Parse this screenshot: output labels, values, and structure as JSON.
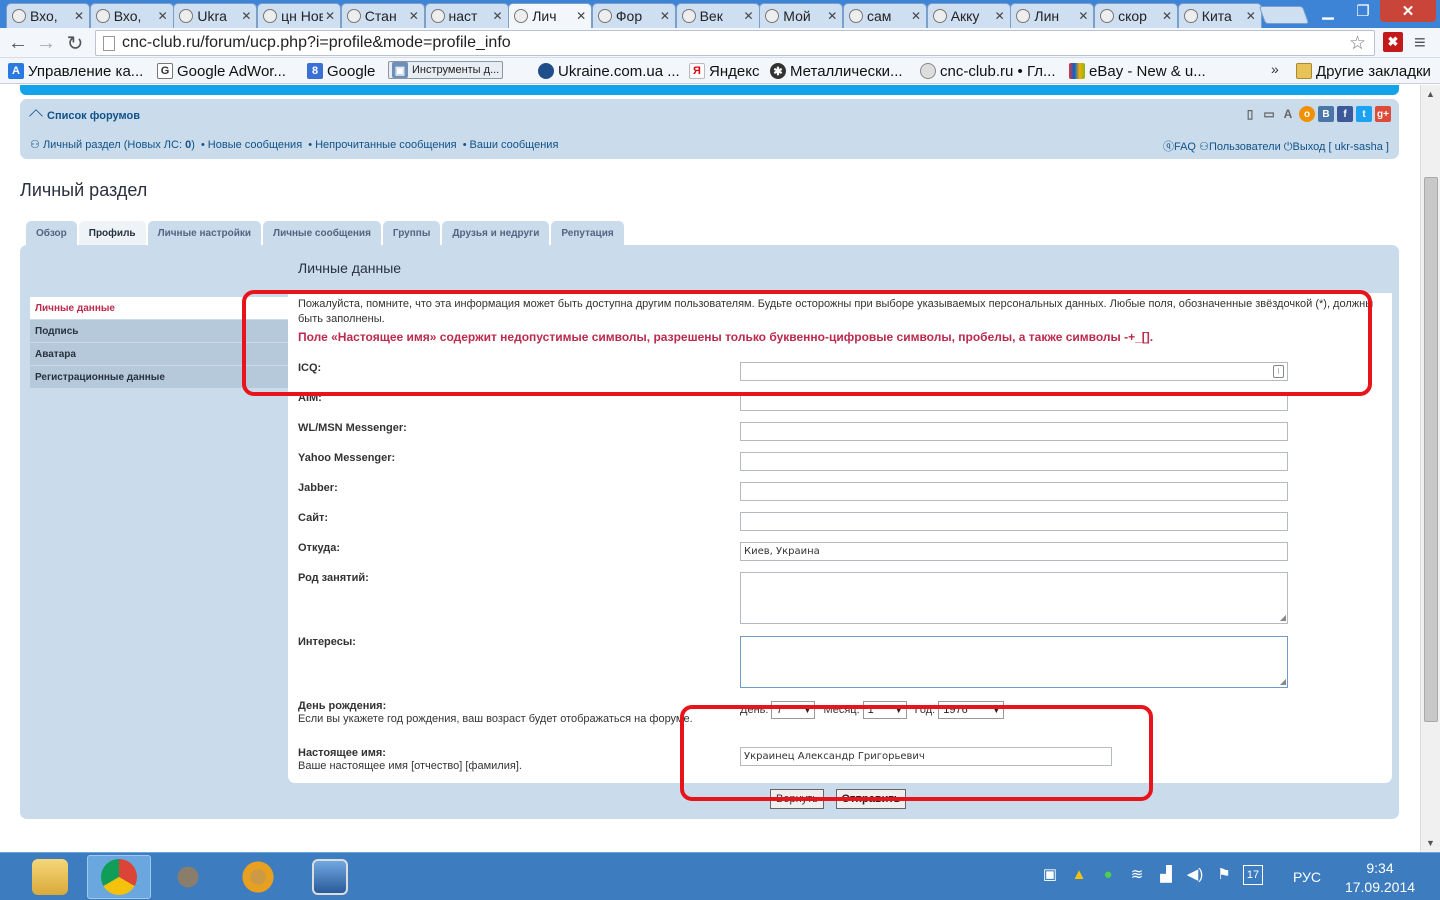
{
  "browser": {
    "tabs": [
      {
        "label": "Вхо,",
        "icon": "mail-icon"
      },
      {
        "label": "Вхо,",
        "icon": "gmail-icon"
      },
      {
        "label": "Ukra",
        "icon": "globe-icon"
      },
      {
        "label": "цн Нов",
        "icon": "site-icon"
      },
      {
        "label": "Стан",
        "icon": "cnc-icon"
      },
      {
        "label": "наст",
        "icon": "gear-icon"
      },
      {
        "label": "Лич",
        "icon": "cnc-icon"
      },
      {
        "label": "Фор",
        "icon": "cnc-icon"
      },
      {
        "label": "Век",
        "icon": "cnc-icon"
      },
      {
        "label": "Мой",
        "icon": "cnc-icon"
      },
      {
        "label": "сам",
        "icon": "cnc-icon"
      },
      {
        "label": "Акку",
        "icon": "cnc-icon"
      },
      {
        "label": "Лин",
        "icon": "cnc-icon"
      },
      {
        "label": "скор",
        "icon": "cnc-icon"
      },
      {
        "label": "Кита",
        "icon": "cnc-icon"
      }
    ],
    "active_tab_index": 6,
    "url": "cnc-club.ru/forum/ucp.php?i=profile&mode=profile_info",
    "bookmarks": [
      {
        "label": "Управление ка...",
        "icon": "adwords-icon"
      },
      {
        "label": "Google AdWor...",
        "icon": "google-icon"
      },
      {
        "label": "Google",
        "icon": "google-icon"
      },
      {
        "label": "Инструменты д...",
        "icon": "tools-icon"
      },
      {
        "label": "Ukraine.com.ua ...",
        "icon": "globe-icon"
      },
      {
        "label": "Яндекс",
        "icon": "yandex-icon"
      },
      {
        "label": "Металлически...",
        "icon": "gear-icon"
      },
      {
        "label": "cnc-club.ru • Гл...",
        "icon": "cnc-icon"
      },
      {
        "label": "eBay - New & u...",
        "icon": "ebay-icon"
      }
    ],
    "bookmarks_more": "»",
    "other_bookmarks": "Другие закладки"
  },
  "forum": {
    "breadcrumb": "Список форумов",
    "user_links": {
      "private": "Личный раздел (Новых ЛС: ",
      "private_count": "0",
      "private_end": ")",
      "new_posts": "Новые сообщения",
      "unread": "Непрочитанные сообщения",
      "your_posts": "Ваши сообщения"
    },
    "right_links": {
      "faq": "FAQ",
      "users": "Пользователи",
      "logout": "Выход [ ukr-sasha ]"
    },
    "share_icons": [
      "mobile-icon",
      "image-icon",
      "font-size-icon",
      "odnoklassniki-icon",
      "vkontakte-icon",
      "facebook-icon",
      "twitter-icon",
      "googleplus-icon"
    ]
  },
  "ucp": {
    "title": "Личный раздел",
    "tabs": [
      "Обзор",
      "Профиль",
      "Личные настройки",
      "Личные сообщения",
      "Группы",
      "Друзья и недруги",
      "Репутация"
    ],
    "active_tab_index": 1,
    "subnav": [
      "Личные данные",
      "Подпись",
      "Аватара",
      "Регистрационные данные"
    ],
    "active_subnav_index": 0,
    "section_title": "Личные данные",
    "notice": "Пожалуйста, помните, что эта информация может быть доступна другим пользователям. Будьте осторожны при выборе указываемых персональных данных. Любые поля, обозначенные звёздочкой (*), должны быть заполнены.",
    "error": "Поле «Настоящее имя» содержит недопустимые символы, разрешены только буквенно-цифровые символы, пробелы, а также символы -+_[].",
    "fields": {
      "icq": {
        "label": "ICQ:",
        "value": ""
      },
      "aim": {
        "label": "AIM:",
        "value": ""
      },
      "msn": {
        "label": "WL/MSN Messenger:",
        "value": ""
      },
      "yahoo": {
        "label": "Yahoo Messenger:",
        "value": ""
      },
      "jabber": {
        "label": "Jabber:",
        "value": ""
      },
      "site": {
        "label": "Сайт:",
        "value": ""
      },
      "location": {
        "label": "Откуда:",
        "value": "Киев, Украина"
      },
      "occupation": {
        "label": "Род занятий:",
        "value": ""
      },
      "interests": {
        "label": "Интересы:",
        "value": ""
      },
      "birthday": {
        "label": "День рождения:",
        "hint": "Если вы укажете год рождения, ваш возраст будет отображаться на форуме.",
        "day_label": "День:",
        "day": "7",
        "month_label": "Месяц:",
        "month": "1",
        "year_label": "Год:",
        "year": "1976"
      },
      "realname": {
        "label": "Настоящее имя:",
        "hint": "Ваше настоящее имя [отчество] [фамилия].",
        "value": "Украинец Александр Григорьевич"
      }
    },
    "buttons": {
      "reset": "Вернуть",
      "submit": "Отправить"
    }
  },
  "taskbar": {
    "apps": [
      "file-explorer-icon",
      "chrome-icon",
      "gimp-icon",
      "media-player-icon",
      "remote-desktop-icon"
    ],
    "active_app_index": 1,
    "tray_icons": [
      "accessibility-icon",
      "google-drive-icon",
      "chat-icon",
      "network-icon",
      "signal-icon",
      "volume-icon",
      "flag-icon",
      "calendar-icon"
    ],
    "language": "РУС",
    "time": "9:34",
    "date": "17.09.2014"
  },
  "colors": {
    "forum_link": "#105289",
    "panel_bg": "#cadceb",
    "error_red": "#bc2a4d",
    "highlight_red": "#e8141b",
    "tabstrip_blue": "#3e84d6",
    "taskbar_blue": "#3c7cbf"
  }
}
